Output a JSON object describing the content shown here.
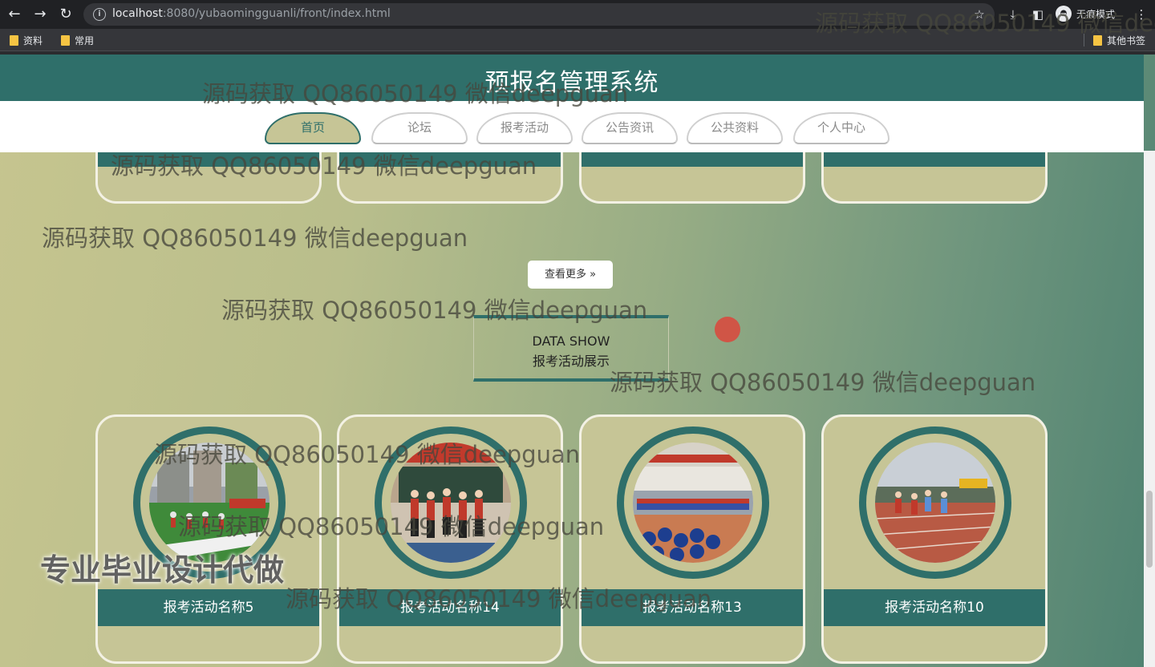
{
  "browser": {
    "url_host": "localhost",
    "url_port": ":8080",
    "url_path": "/yubaomingguanli/front/index.html",
    "profile_label": "无痕模式",
    "bookmarks": [
      "资料",
      "常用"
    ],
    "other_bookmarks": "其他书签"
  },
  "site": {
    "title": "预报名管理系统",
    "menu": [
      "首页",
      "论坛",
      "报考活动",
      "公告资讯",
      "公共资料",
      "个人中心"
    ],
    "active_menu": "首页",
    "more_button": "查看更多 »",
    "section": {
      "en": "DATA SHOW",
      "zh": "报考活动展示"
    },
    "cards": [
      {
        "label": "报考活动名称5",
        "photo": "sports-field-photo"
      },
      {
        "label": "报考活动名称14",
        "photo": "classroom-dance-photo"
      },
      {
        "label": "报考活动名称13",
        "photo": "gym-performance-photo"
      },
      {
        "label": "报考活动名称10",
        "photo": "running-track-photo"
      }
    ]
  },
  "watermarks": {
    "qq": "源码获取 QQ86050149 微信deepguan",
    "big": "专业毕业设计代做"
  },
  "colors": {
    "primary": "#2f6f6a",
    "card_bg": "#c6c596",
    "bg_left": "#c6c58f",
    "bg_right": "#4f8271"
  }
}
